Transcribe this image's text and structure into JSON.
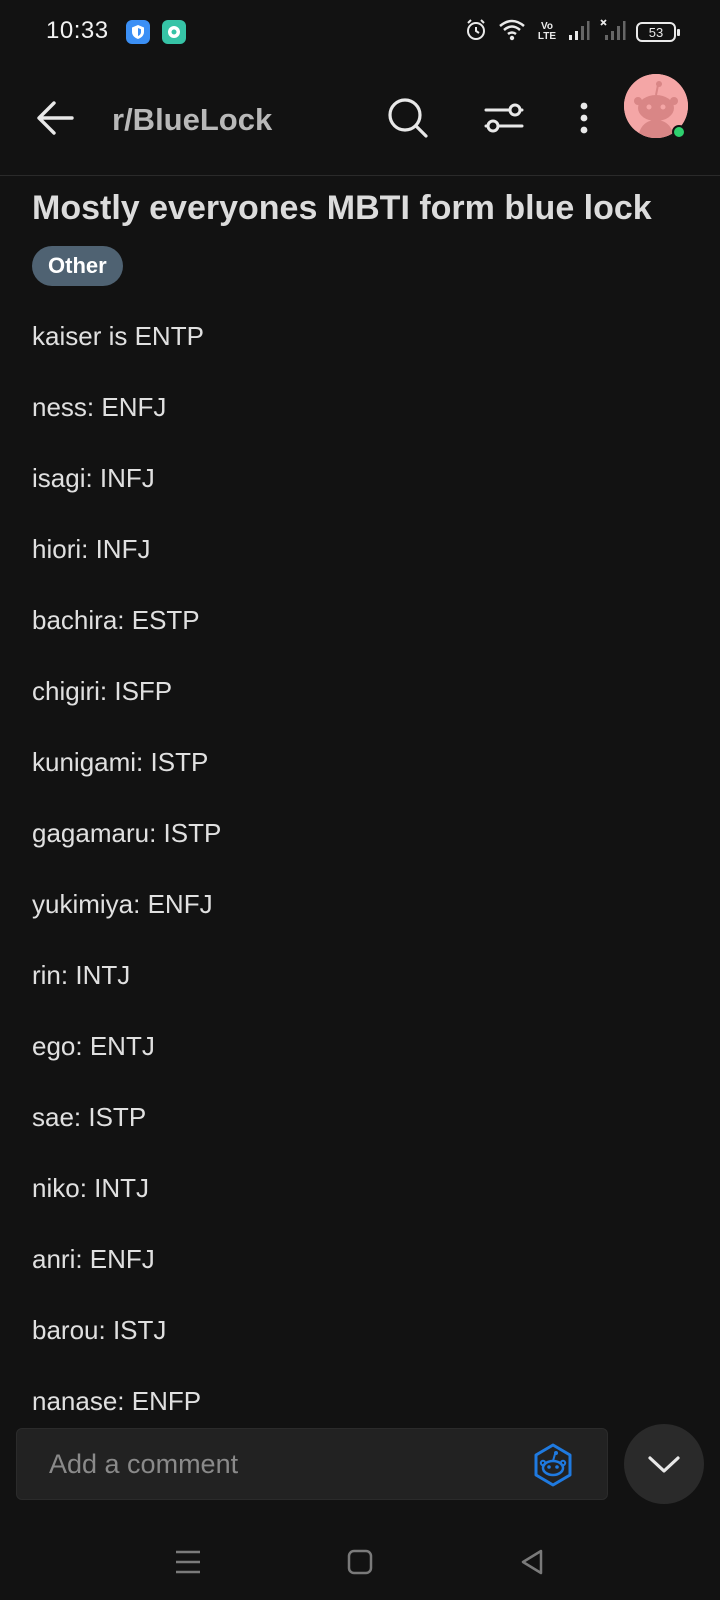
{
  "status_bar": {
    "time": "10:33",
    "battery": "53",
    "volte": "Vo LTE",
    "icons": [
      "vpn-shield-icon",
      "chat-bubble-icon",
      "alarm-icon",
      "wifi-icon",
      "signal-icon",
      "no-signal-icon",
      "battery-icon"
    ]
  },
  "app_bar": {
    "subreddit": "r/BlueLock",
    "icons": [
      "back-arrow-icon",
      "search-icon",
      "filter-icon",
      "more-vertical-icon",
      "avatar"
    ]
  },
  "post": {
    "title": "Mostly everyones MBTI form blue lock",
    "flair": "Other",
    "lines": [
      "kaiser is ENTP",
      "ness: ENFJ",
      "isagi: INFJ",
      "hiori: INFJ",
      "bachira: ESTP",
      "chigiri: ISFP",
      "kunigami: ISTP",
      "gagamaru: ISTP",
      "yukimiya: ENFJ",
      "rin: INTJ",
      "ego: ENTJ",
      "sae: ISTP",
      "niko: INTJ",
      "anri: ENFJ",
      "barou: ISTJ",
      "nanase: ENFP"
    ]
  },
  "comment_bar": {
    "placeholder": "Add a comment"
  },
  "colors": {
    "background": "#121212",
    "flair": "#4f6272",
    "accent_blue": "#1f7ae0",
    "online": "#2ed06e",
    "avatar_bg": "#f4a6a6"
  }
}
